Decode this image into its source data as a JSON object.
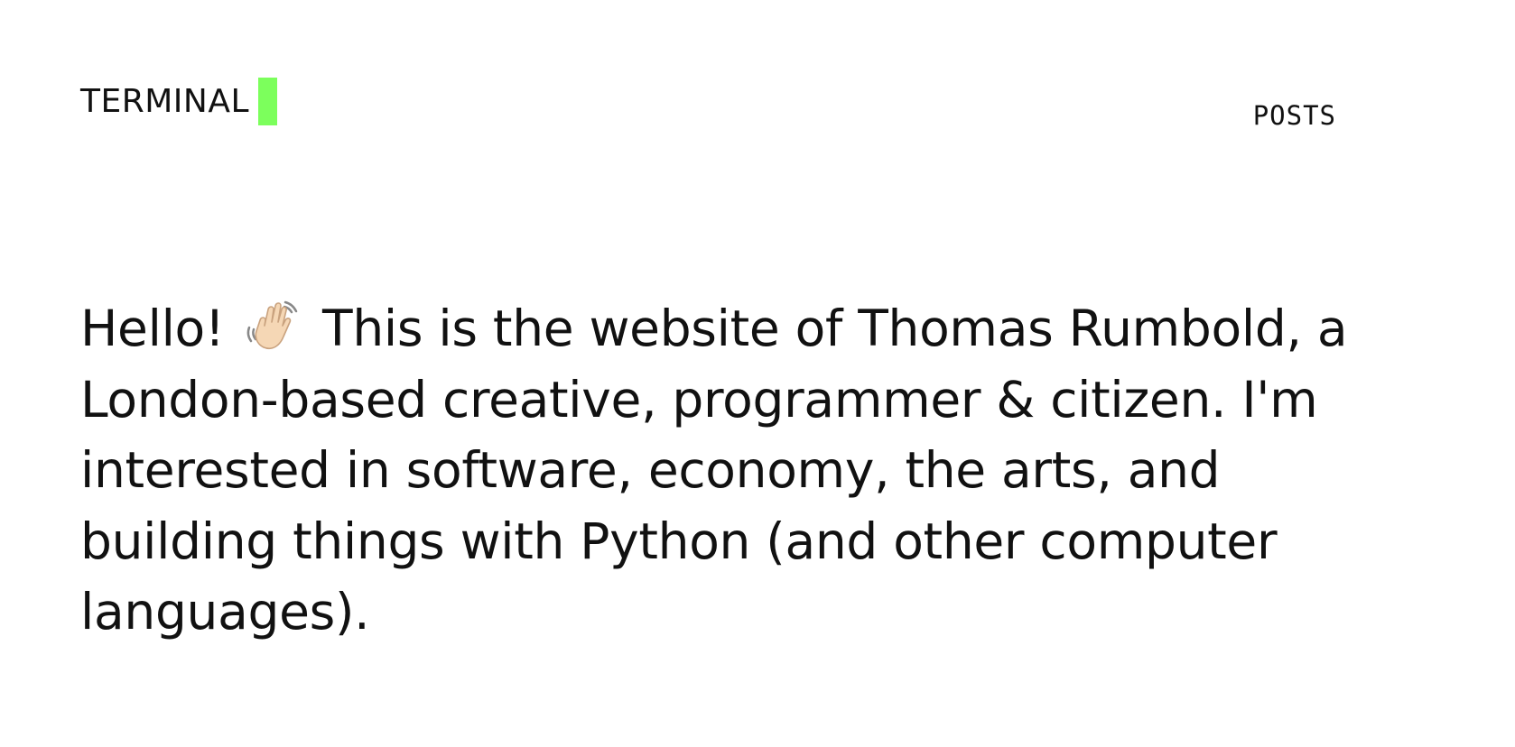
{
  "header": {
    "brand_label": "TERMINAL",
    "cursor_color": "#7CFF5C",
    "nav": {
      "posts_label": "POSTS"
    }
  },
  "hero": {
    "greeting": "Hello!",
    "greeting_icon": "waving-hand-icon",
    "intro": " This is the website of Thomas Rumbold, a London-based creative, programmer & citizen. I'm interested in software, economy, the arts, and building things with Python (and other computer languages)."
  }
}
